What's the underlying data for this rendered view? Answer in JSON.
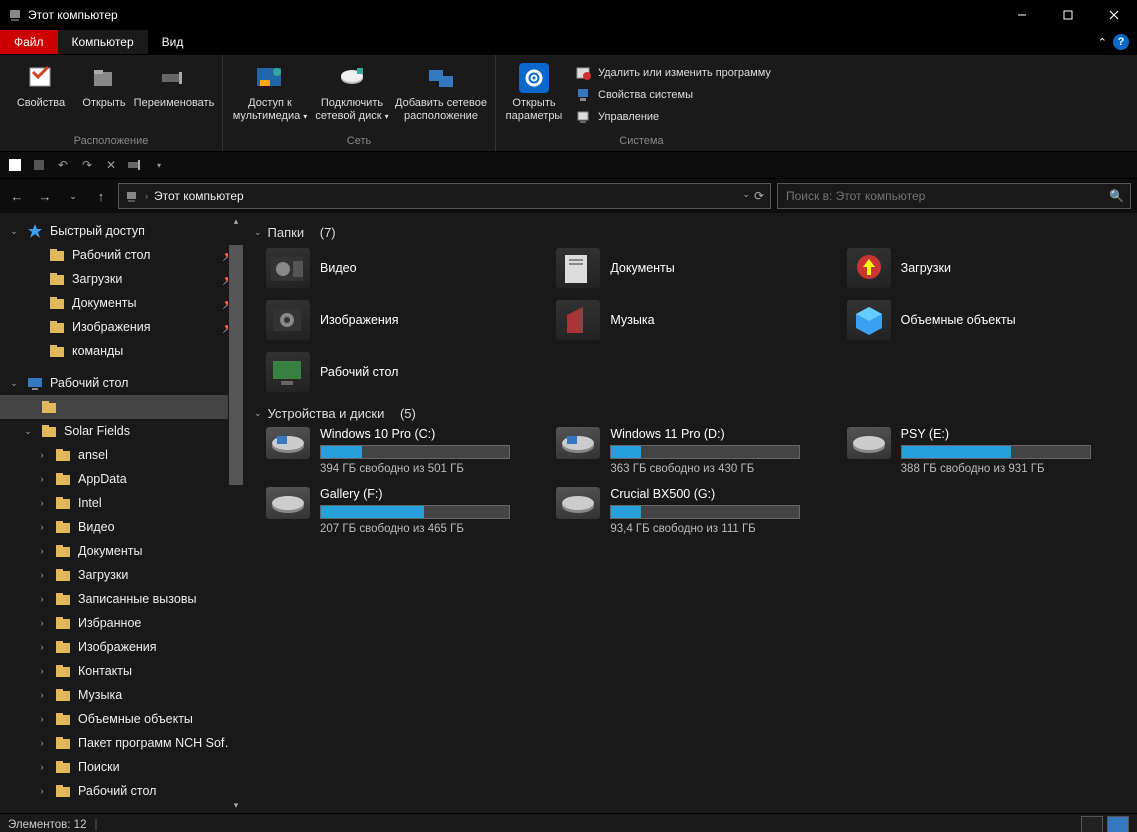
{
  "window": {
    "title": "Этот компьютер"
  },
  "menutabs": {
    "file": "Файл",
    "computer": "Компьютер",
    "view": "Вид"
  },
  "ribbon": {
    "location": {
      "group": "Расположение",
      "properties": "Свойства",
      "open": "Открыть",
      "rename": "Переименовать"
    },
    "network": {
      "group": "Сеть",
      "media": "Доступ к мультимедиа",
      "map_drive": "Подключить сетевой диск",
      "add_location": "Добавить сетевое расположение"
    },
    "system": {
      "group": "Система",
      "open_settings": "Открыть параметры",
      "uninstall": "Удалить или изменить программу",
      "sysprops": "Свойства системы",
      "manage": "Управление"
    }
  },
  "address": {
    "crumb": "Этот компьютер"
  },
  "search": {
    "placeholder": "Поиск в: Этот компьютер"
  },
  "sidebar": {
    "quick_access": "Быстрый доступ",
    "qa_items": [
      {
        "label": "Рабочий стол",
        "pin": true
      },
      {
        "label": "Загрузки",
        "pin": true
      },
      {
        "label": "Документы",
        "pin": true
      },
      {
        "label": "Изображения",
        "pin": true
      },
      {
        "label": "команды",
        "pin": false
      }
    ],
    "desktop": "Рабочий стол",
    "user": "Solar Fields",
    "user_items": [
      "ansel",
      "AppData",
      "Intel",
      "Видео",
      "Документы",
      "Загрузки",
      "Записанные вызовы",
      "Избранное",
      "Изображения",
      "Контакты",
      "Музыка",
      "Объемные объекты",
      "Пакет программ NCH Software",
      "Поиски",
      "Рабочий стол"
    ]
  },
  "sections": {
    "folders": {
      "title": "Папки",
      "count": "(7)"
    },
    "drives": {
      "title": "Устройства и диски",
      "count": "(5)"
    }
  },
  "folders": [
    {
      "label": "Видео"
    },
    {
      "label": "Документы"
    },
    {
      "label": "Загрузки"
    },
    {
      "label": "Изображения"
    },
    {
      "label": "Музыка"
    },
    {
      "label": "Объемные объекты"
    },
    {
      "label": "Рабочий стол"
    }
  ],
  "drives": [
    {
      "name": "Windows 10 Pro (C:)",
      "free": "394 ГБ свободно из 501 ГБ",
      "fill": 22
    },
    {
      "name": "Windows 11 Pro (D:)",
      "free": "363 ГБ свободно из 430 ГБ",
      "fill": 16
    },
    {
      "name": "PSY (E:)",
      "free": "388 ГБ свободно из 931 ГБ",
      "fill": 58
    },
    {
      "name": "Gallery (F:)",
      "free": "207 ГБ свободно из 465 ГБ",
      "fill": 55
    },
    {
      "name": "Crucial BX500 (G:)",
      "free": "93,4 ГБ свободно из 111 ГБ",
      "fill": 16
    }
  ],
  "status": {
    "items": "Элементов: 12"
  }
}
